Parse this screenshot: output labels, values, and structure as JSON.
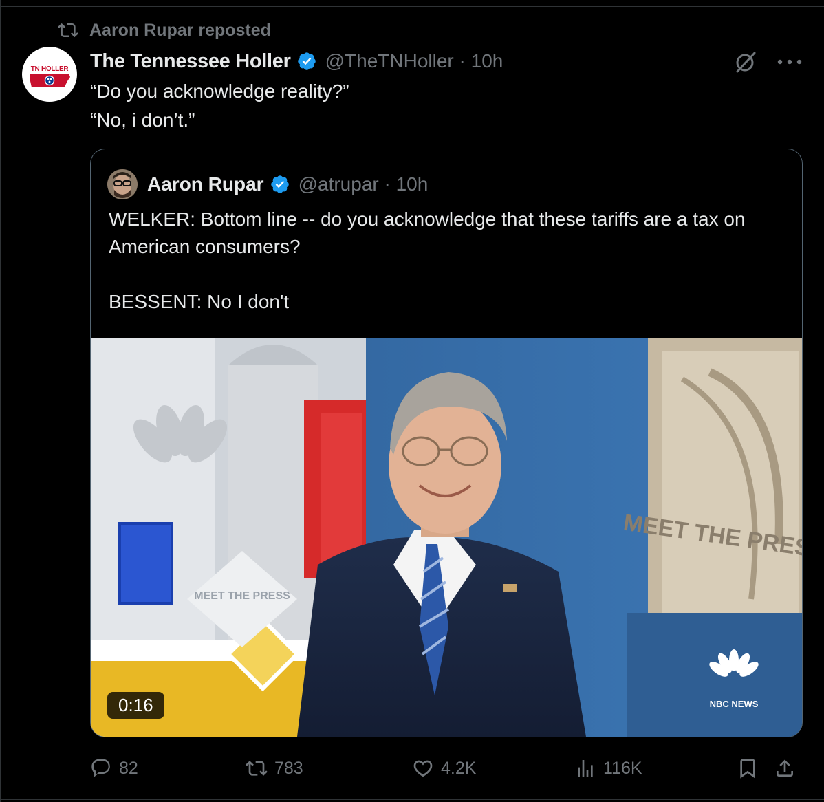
{
  "repost": {
    "label": "Aaron Rupar reposted",
    "icon": "repost-icon"
  },
  "tweet": {
    "avatar_text": "TN HOLLER",
    "author_name": "The Tennessee Holler",
    "handle_time": "@TheTNHoller · 10h",
    "line1": "“Do you acknowledge reality?”",
    "line2": "“No, i don’t.”"
  },
  "quote": {
    "author_name": "Aaron Rupar",
    "handle_time": "@atrupar · 10h",
    "text": "WELKER: Bottom line -- do you acknowledge that these tariffs are a tax on American consumers?\n\nBESSENT: No I don't",
    "video": {
      "duration": "0:16",
      "set_logo_left": "MEET THE PRESS",
      "set_logo_right": "MEET THE PRESS",
      "network": "NBC NEWS"
    }
  },
  "actions": {
    "replies": "82",
    "reposts": "783",
    "likes": "4.2K",
    "views": "116K"
  },
  "colors": {
    "background": "#000000",
    "text": "#e7e9ea",
    "secondary": "#71767b",
    "verified": "#1d9bf0",
    "border": "#536471"
  }
}
